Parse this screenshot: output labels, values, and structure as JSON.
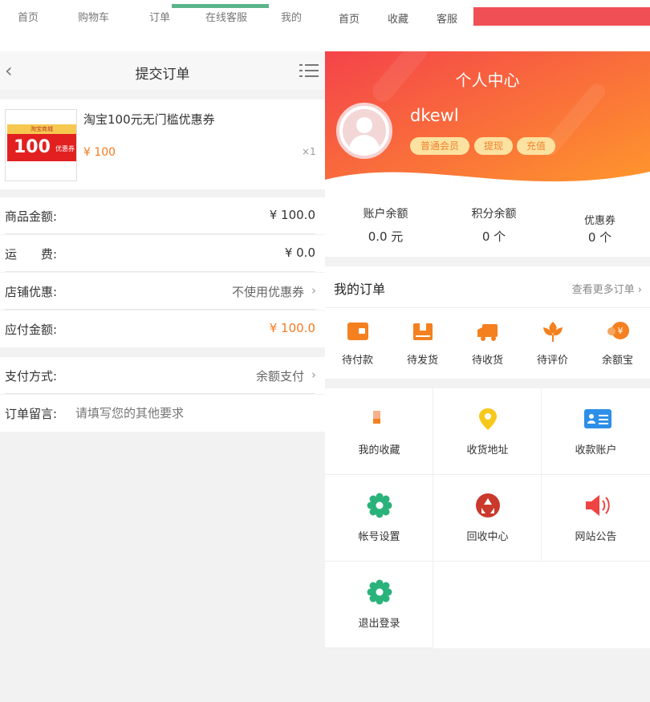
{
  "left_tabs": [
    "首页",
    "购物车",
    "订单",
    "在线客服",
    "我的"
  ],
  "right_tabs": [
    "首页",
    "收藏",
    "客服"
  ],
  "order_page": {
    "title": "提交订单",
    "product": {
      "name": "淘宝100元无门槛优惠券",
      "price": "¥ 100",
      "qty": "×1",
      "thumb_strip": "淘宝商城",
      "thumb_amount": "100",
      "thumb_tag": "优惠券"
    },
    "rows": {
      "goods_amount": {
        "label": "商品金额:",
        "value": "¥ 100.0"
      },
      "shipping": {
        "label": "运　　费:",
        "value": "¥ 0.0"
      },
      "store_discount": {
        "label": "店铺优惠:",
        "value": "不使用优惠券"
      },
      "payable": {
        "label": "应付金额:",
        "value": "¥ 100.0"
      },
      "payment": {
        "label": "支付方式:",
        "value": "余额支付"
      },
      "remark": {
        "label": "订单留言:",
        "placeholder": "请填写您的其他要求"
      }
    },
    "accent": "#f47a20"
  },
  "user_center": {
    "title": "个人中心",
    "username": "dkewl",
    "badges": [
      "普通会员",
      "提现",
      "充值"
    ],
    "balances": [
      {
        "label": "账户余额",
        "value": "0.0 元"
      },
      {
        "label": "积分余额",
        "value": "0 个"
      },
      {
        "label": "优惠券",
        "value": "0 个"
      }
    ],
    "orders": {
      "title": "我的订单",
      "more": "查看更多订单 ›",
      "items": [
        "待付款",
        "待发货",
        "待收货",
        "待评价",
        "余额宝"
      ]
    },
    "grid": [
      "我的收藏",
      "收货地址",
      "收款账户",
      "帐号设置",
      "回收中心",
      "网站公告",
      "退出登录"
    ],
    "hero_colors": [
      "#f4434a",
      "#ff8c2b"
    ]
  }
}
